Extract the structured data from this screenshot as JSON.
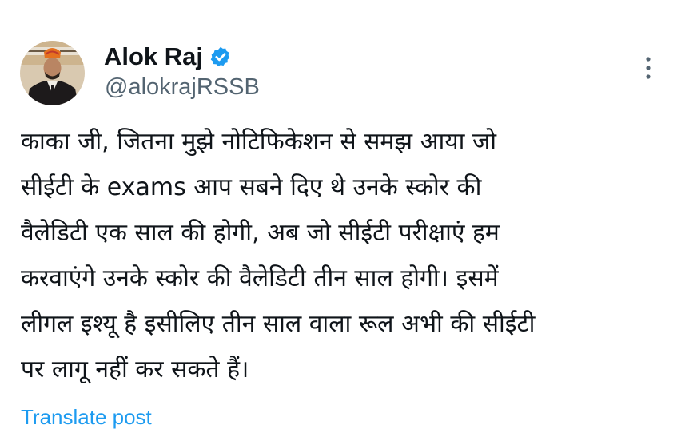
{
  "post": {
    "author": {
      "display_name": "Alok Raj",
      "handle": "@alokrajRSSB",
      "verified": true,
      "avatar_icon": "profile-photo",
      "verified_icon": "verified-badge-icon"
    },
    "text_lines": [
      "काका जी, जितना मुझे नोटिफिकेशन से समझ आया जो",
      "सीईटी के exams आप सबने दिए थे उनके स्कोर की",
      "वैलेडिटी एक साल की होगी, अब जो सीईटी परीक्षाएं हम",
      "करवाएंगे उनके स्कोर की वैलेडिटी तीन साल होगी। इसमें",
      "लीगल इश्यू है इसीलिए तीन साल वाला रूल अभी की सीईटी",
      "पर लागू नहीं कर सकते हैं।"
    ],
    "translate_label": "Translate post",
    "more_icon": "more-options-icon"
  },
  "colors": {
    "text": "#0f1419",
    "secondary": "#536471",
    "accent": "#1d9bf0",
    "verified": "#1d9bf0",
    "divider": "#eff3f4"
  }
}
